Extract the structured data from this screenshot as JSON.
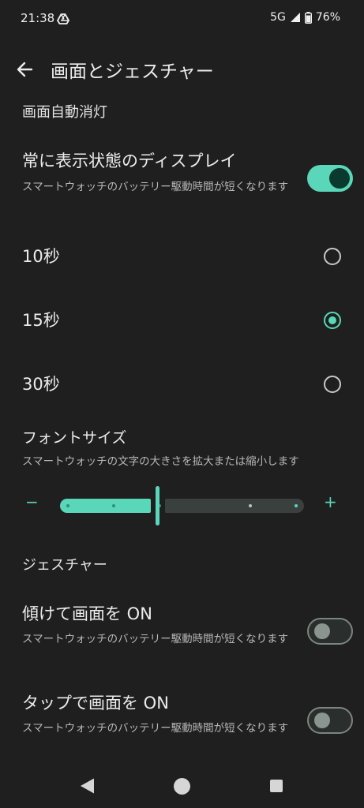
{
  "status_bar": {
    "time": "21:38",
    "network": "5G",
    "battery": "76%",
    "icons": [
      "google-drive-icon",
      "signal-icon",
      "battery-icon"
    ]
  },
  "header": {
    "title": "画面とジェスチャー",
    "back_icon": "arrow-back-icon"
  },
  "screen_timeout": {
    "header": "画面自動消灯",
    "always_on": {
      "title": "常に表示状態のディスプレイ",
      "subtitle": "スマートウォッチのバッテリー駆動時間が短くなります",
      "enabled": true
    },
    "options": [
      {
        "label": "10秒",
        "selected": false
      },
      {
        "label": "15秒",
        "selected": true
      },
      {
        "label": "30秒",
        "selected": false
      }
    ]
  },
  "font_size": {
    "title": "フォントサイズ",
    "subtitle": "スマートウォッチの文字の大きさを拡大または縮小します",
    "minus_label": "−",
    "plus_label": "+",
    "steps": 6,
    "value_step": 3
  },
  "gestures": {
    "header": "ジェスチャー",
    "tilt": {
      "title": "傾けて画面を ON",
      "subtitle": "スマートウォッチのバッテリー駆動時間が短くなります",
      "enabled": false
    },
    "tap": {
      "title": "タップで画面を ON",
      "subtitle": "スマートウォッチのバッテリー駆動時間が短くなります",
      "enabled": false
    }
  },
  "colors": {
    "accent": "#5ad6b8",
    "background": "#1f1f1f"
  },
  "nav": {
    "icons": [
      "nav-back-icon",
      "nav-home-icon",
      "nav-recents-icon"
    ]
  }
}
